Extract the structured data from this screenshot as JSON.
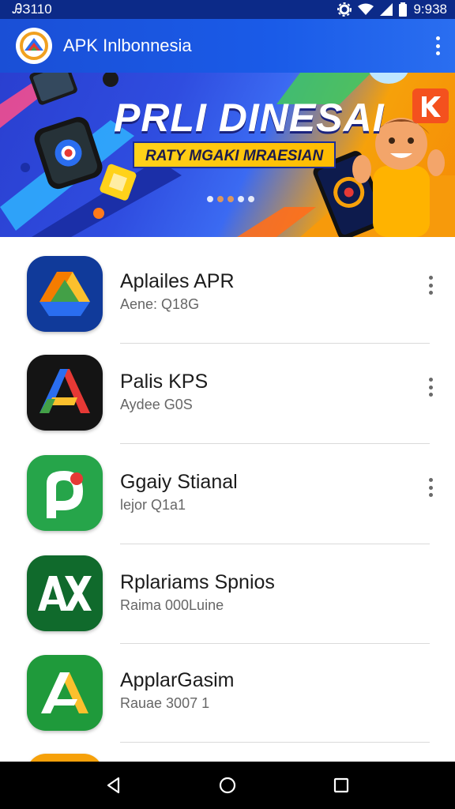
{
  "status_bar": {
    "left_text": "ᎯЗ110",
    "time": "9:938",
    "icons": [
      "gear-icon",
      "wifi-icon",
      "signal-icon",
      "battery-icon"
    ]
  },
  "app_bar": {
    "title": "APK Inlbonnesia",
    "logo_icon": "app-logo-icon",
    "menu_icon": "more-vert-icon"
  },
  "banner": {
    "title": "PRLI DINESAI",
    "subtitle": "RATY MGAKI MRAESIAN",
    "pager": {
      "count": 5,
      "active": 1
    }
  },
  "apps": [
    {
      "name": "Aplailes APR",
      "meta": "Aene: Q18G",
      "icon": "drive-triangle-icon",
      "bg": "#103a9a",
      "menu": true
    },
    {
      "name": "Palis KPS",
      "meta": "Aydee G0S",
      "icon": "a-letter-icon",
      "bg": "#141414",
      "menu": true
    },
    {
      "name": "Ggaiy Stianal",
      "meta": "lejor Q1a1",
      "icon": "p-letter-icon",
      "bg": "#26a54a",
      "menu": true
    },
    {
      "name": "Rplariams Spnios",
      "meta": "Raima 000Luine",
      "icon": "ax-letters-icon",
      "bg": "#106a2c",
      "menu": false
    },
    {
      "name": "ApplarGasim",
      "meta": "Rauae 3007 1",
      "icon": "a-triangle-icon",
      "bg": "#1f9a3b",
      "menu": false
    }
  ],
  "nav_bar": {
    "back_icon": "back-triangle-icon",
    "home_icon": "home-circle-icon",
    "recents_icon": "recents-square-icon"
  },
  "colors": {
    "status_bar": "#0c2a88",
    "app_bar": "#1a4fd6",
    "banner_orange": "#f6a10a",
    "nav_bar": "#000000"
  }
}
